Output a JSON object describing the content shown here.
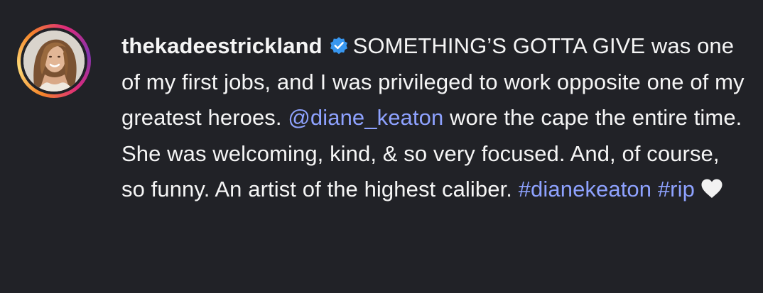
{
  "post": {
    "username": "thekadeestrickland",
    "verified_icon": "verified-badge-icon",
    "caption_part1": "SOMETHING’S GOTTA GIVE was one of my first jobs, and I was privileged to work opposite one of my greatest heroes.",
    "mention": "@diane_keaton",
    "caption_part2": "wore the cape the entire time. She was welcoming, kind, & so very focused. And, of course, so funny. An artist of the highest caliber.",
    "hashtags": [
      "#dianekeaton",
      "#rip"
    ],
    "emoji": "white-heart-icon",
    "colors": {
      "background": "#212227",
      "text": "#f5f5f5",
      "link": "#8ea2ff",
      "verified": "#3897f0"
    }
  }
}
